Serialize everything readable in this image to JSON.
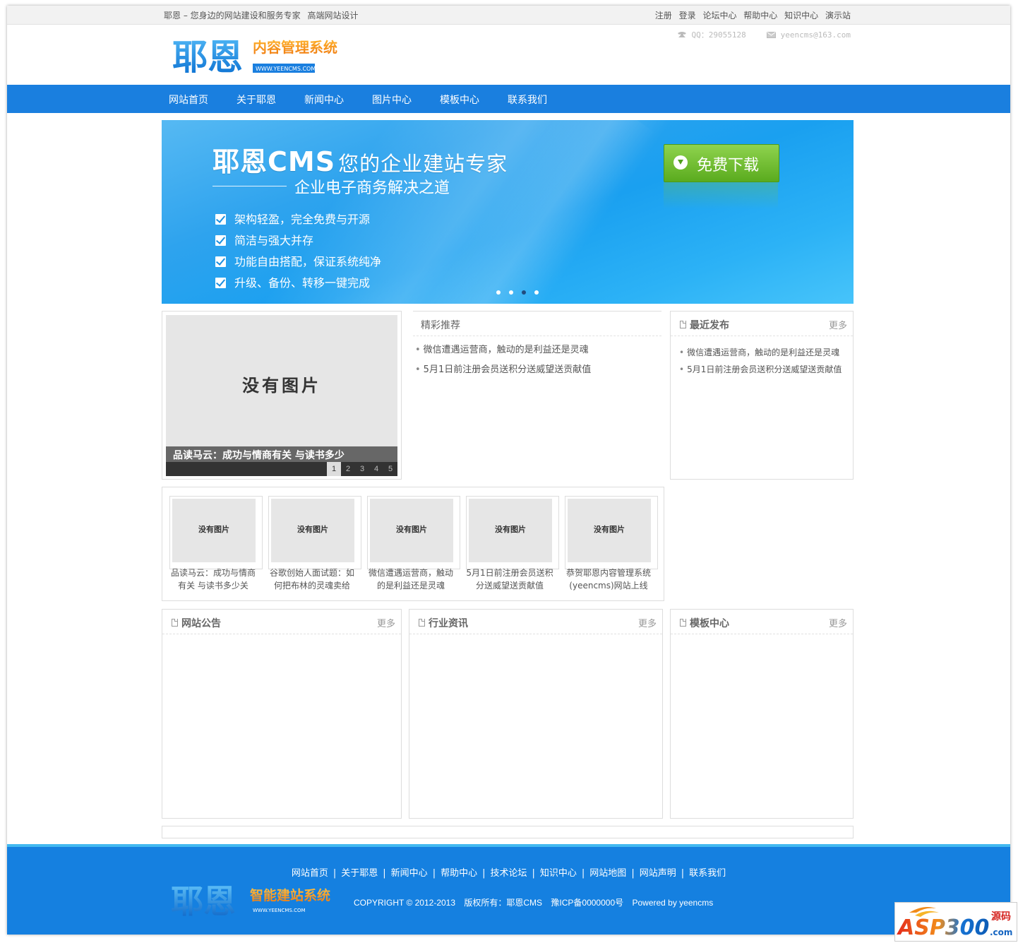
{
  "topbar": {
    "slogan": "耶恩 – 您身边的网站建设和服务专家",
    "slogan2": "高端网站设计",
    "links": [
      "注册",
      "登录",
      "论坛中心",
      "帮助中心",
      "知识中心",
      "演示站"
    ]
  },
  "header": {
    "logo_main": "耶恩",
    "logo_sub": "内容管理系统",
    "logo_url": "WWW.YEENCMS.COM",
    "qq": "QQ：29055128",
    "email": "yeencms@163.com"
  },
  "nav": [
    "网站首页",
    "关于耶恩",
    "新闻中心",
    "图片中心",
    "模板中心",
    "联系我们"
  ],
  "banner": {
    "title_brand": "耶恩CMS",
    "title_rest": "您的企业建站专家",
    "subtitle": "企业电子商务解决之道",
    "features": [
      "架构轻盈，完全免费与开源",
      "简洁与强大并存",
      "功能自由搭配，保证系统纯净",
      "升级、备份、转移一键完成"
    ],
    "download": "免费下载",
    "active_dot": 3
  },
  "slider": {
    "placeholder": "没有图片",
    "caption": "品读马云：成功与情商有关 与读书多少",
    "pages": [
      "1",
      "2",
      "3",
      "4",
      "5"
    ],
    "active_page": 1
  },
  "featured": {
    "title": "精彩推荐",
    "items": [
      "微信遭遇运营商，触动的是利益还是灵魂",
      "5月1日前注册会员送积分送威望送贡献值"
    ]
  },
  "recent": {
    "title": "最近发布",
    "more": "更多",
    "items": [
      "微信遭遇运营商，触动的是利益还是灵魂",
      "5月1日前注册会员送积分送威望送贡献值"
    ]
  },
  "gallery": {
    "placeholder": "没有图片",
    "items": [
      {
        "line1": "品读马云：成功与情商",
        "line2": "有关 与读书多少关"
      },
      {
        "line1": "谷歌创始人面试题：如",
        "line2": "何把布林的灵魂卖给"
      },
      {
        "line1": "微信遭遇运营商，触动",
        "line2": "的是利益还是灵魂"
      },
      {
        "line1": "5月1日前注册会员送积",
        "line2": "分送威望送贡献值"
      },
      {
        "line1": "恭贺耶恩内容管理系统",
        "line2": "(yeencms)网站上线"
      }
    ]
  },
  "sections": [
    {
      "title": "网站公告",
      "more": "更多"
    },
    {
      "title": "行业资讯",
      "more": "更多"
    },
    {
      "title": "模板中心",
      "more": "更多"
    }
  ],
  "footer": {
    "links": [
      "网站首页",
      "关于耶恩",
      "新闻中心",
      "帮助中心",
      "技术论坛",
      "知识中心",
      "网站地图",
      "网站声明",
      "联系我们"
    ],
    "copyright": "COPYRIGHT © 2012-2013",
    "owner": "版权所有：耶恩CMS",
    "icp": "豫ICP备0000000号",
    "powered": "Powered by yeencms",
    "logo_main": "耶恩",
    "logo_sub": "智能建站系统",
    "logo_url": "WWW.YEENCMS.COM"
  },
  "watermark": {
    "text": "ASP300",
    "sub1": "源码",
    "sub2": ".com"
  },
  "colors": {
    "nav": "#1a7fdf",
    "footer": "#1580e0",
    "accent_orange": "#f39b1b",
    "download_green": "#6cbd2c"
  }
}
